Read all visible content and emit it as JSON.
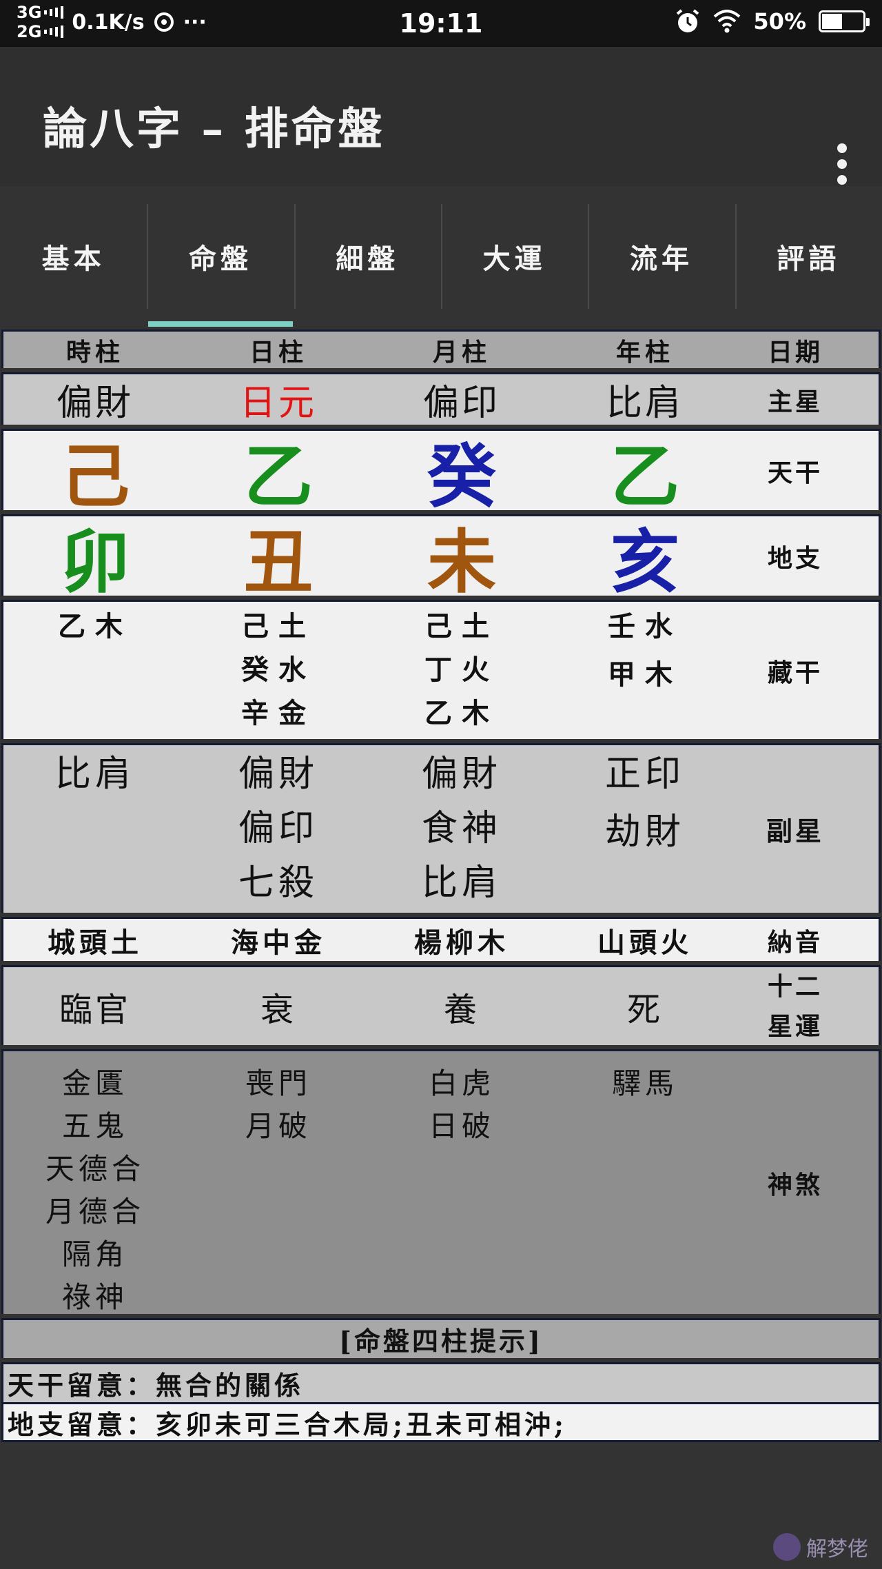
{
  "status_bar": {
    "net_3g": "3G",
    "net_2g": "2G",
    "speed": "0.1K/s",
    "more": "···",
    "time": "19:11",
    "battery": "50%",
    "battery_level": 0.5
  },
  "app": {
    "title": "論八字 – 排命盤"
  },
  "tabs": [
    {
      "label": "基本",
      "active": false
    },
    {
      "label": "命盤",
      "active": true
    },
    {
      "label": "細盤",
      "active": false
    },
    {
      "label": "大運",
      "active": false
    },
    {
      "label": "流年",
      "active": false
    },
    {
      "label": "評語",
      "active": false
    }
  ],
  "colors": {
    "earth": "#a0560f",
    "wood": "#178e1d",
    "water": "#1820a8",
    "red": "#e11414",
    "accent": "#7ecfc6"
  },
  "chart": {
    "header": {
      "hour": "時柱",
      "day": "日柱",
      "month": "月柱",
      "year": "年柱",
      "date": "日期"
    },
    "main_star": {
      "hour": "偏財",
      "day": "日元",
      "month": "偏印",
      "year": "比肩",
      "label": "主星"
    },
    "stems": {
      "hour": "己",
      "day": "乙",
      "month": "癸",
      "year": "乙",
      "label": "天干"
    },
    "branches": {
      "hour": "卯",
      "day": "丑",
      "month": "未",
      "year": "亥",
      "label": "地支"
    },
    "hidden": {
      "hour": [
        "乙木"
      ],
      "day": [
        "己土",
        "癸水",
        "辛金"
      ],
      "month": [
        "己土",
        "丁火",
        "乙木"
      ],
      "year": [
        "壬水",
        "甲木"
      ],
      "label": "藏干"
    },
    "sub_star": {
      "hour": [
        "比肩"
      ],
      "day": [
        "偏財",
        "偏印",
        "七殺"
      ],
      "month": [
        "偏財",
        "食神",
        "比肩"
      ],
      "year": [
        "正印",
        "劫財"
      ],
      "label": "副星"
    },
    "nayin": {
      "hour": "城頭土",
      "day": "海中金",
      "month": "楊柳木",
      "year": "山頭火",
      "label": "納音"
    },
    "twelve": {
      "hour": "臨官",
      "day": "衰",
      "month": "養",
      "year": "死",
      "label_1": "十二",
      "label_2": "星運"
    },
    "shensha": {
      "hour": [
        "金匱",
        "五鬼",
        "天德合",
        "月德合",
        "隔角",
        "祿神"
      ],
      "day": [
        "喪門",
        "月破"
      ],
      "month": [
        "白虎",
        "日破"
      ],
      "year": [
        "驛馬"
      ],
      "label": "神煞"
    }
  },
  "hints": {
    "title": "[命盤四柱提示]",
    "stem_note": "天干留意：無合的關係",
    "branch_note": "地支留意：亥卯未可三合木局;丑未可相沖;"
  },
  "watermark": "解梦佬"
}
